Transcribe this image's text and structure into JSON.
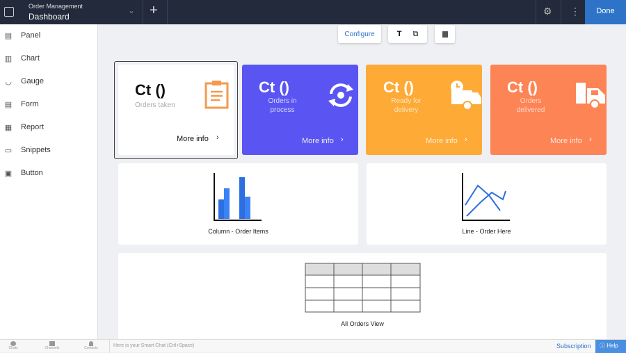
{
  "header": {
    "app_name": "Order Management",
    "page_name": "Dashboard",
    "done_label": "Done"
  },
  "sidebar": {
    "items": [
      {
        "label": "Panel",
        "icon": "panel-icon"
      },
      {
        "label": "Chart",
        "icon": "chart-icon"
      },
      {
        "label": "Gauge",
        "icon": "gauge-icon"
      },
      {
        "label": "Form",
        "icon": "form-icon"
      },
      {
        "label": "Report",
        "icon": "report-icon"
      },
      {
        "label": "Snippets",
        "icon": "snippets-icon"
      },
      {
        "label": "Button",
        "icon": "button-icon"
      }
    ]
  },
  "toolbar": {
    "configure_label": "Configure",
    "text_icon": "T"
  },
  "kpis": [
    {
      "value": "Ct ()",
      "label": "Orders taken",
      "more": "More info",
      "color": "#ffffff",
      "icon": "clipboard-icon"
    },
    {
      "value": "Ct ()",
      "label": "Orders in process",
      "more": "More info",
      "color": "#5a55f2",
      "icon": "sync-icon"
    },
    {
      "value": "Ct ()",
      "label": "Ready for delivery",
      "more": "More info",
      "color": "#fdaa37",
      "icon": "delivery-clock-icon"
    },
    {
      "value": "Ct ()",
      "label": "Orders delivered",
      "more": "More info",
      "color": "#fd8455",
      "icon": "truck-icon"
    }
  ],
  "widgets": {
    "column": "Column - Order Items",
    "line": "Line - Order Here",
    "report": "All Orders View"
  },
  "bottom": {
    "chats": "Chats",
    "channels": "Channels",
    "contacts": "Contacts",
    "smart_chat_placeholder": "Here is your Smart Chat (Ctrl+Space)",
    "subscription": "Subscription",
    "help": "Help"
  }
}
